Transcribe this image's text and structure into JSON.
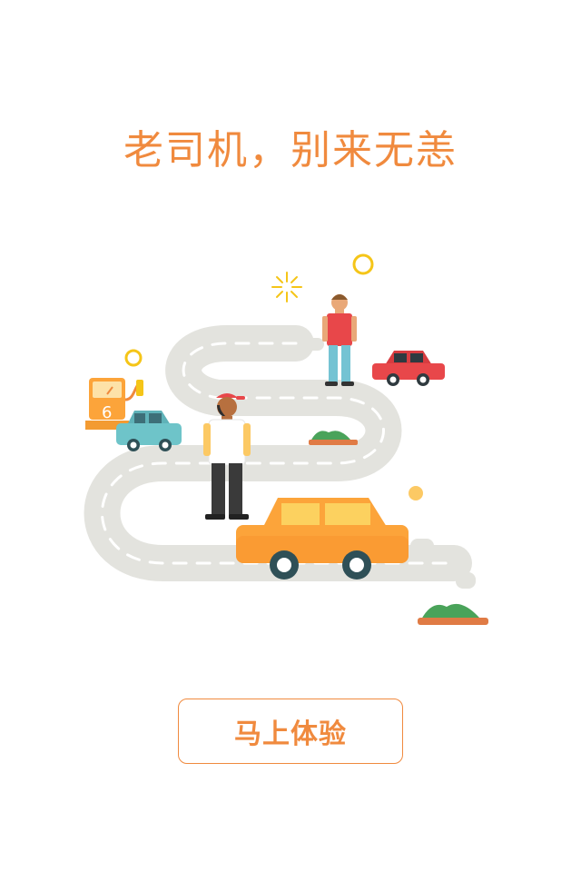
{
  "page": {
    "headline": "老司机，别来无恙"
  },
  "illustration": {
    "description_icon": "road-trip-illustration",
    "colors": {
      "accent": "#f08a3e",
      "road": "#e3e3de",
      "orange_car": "#fca43a",
      "red_car": "#e8474a",
      "blue_car": "#6ec4c9",
      "bush": "#4aa35a",
      "sun": "#f5c518"
    }
  },
  "cta": {
    "label": "马上体验"
  }
}
